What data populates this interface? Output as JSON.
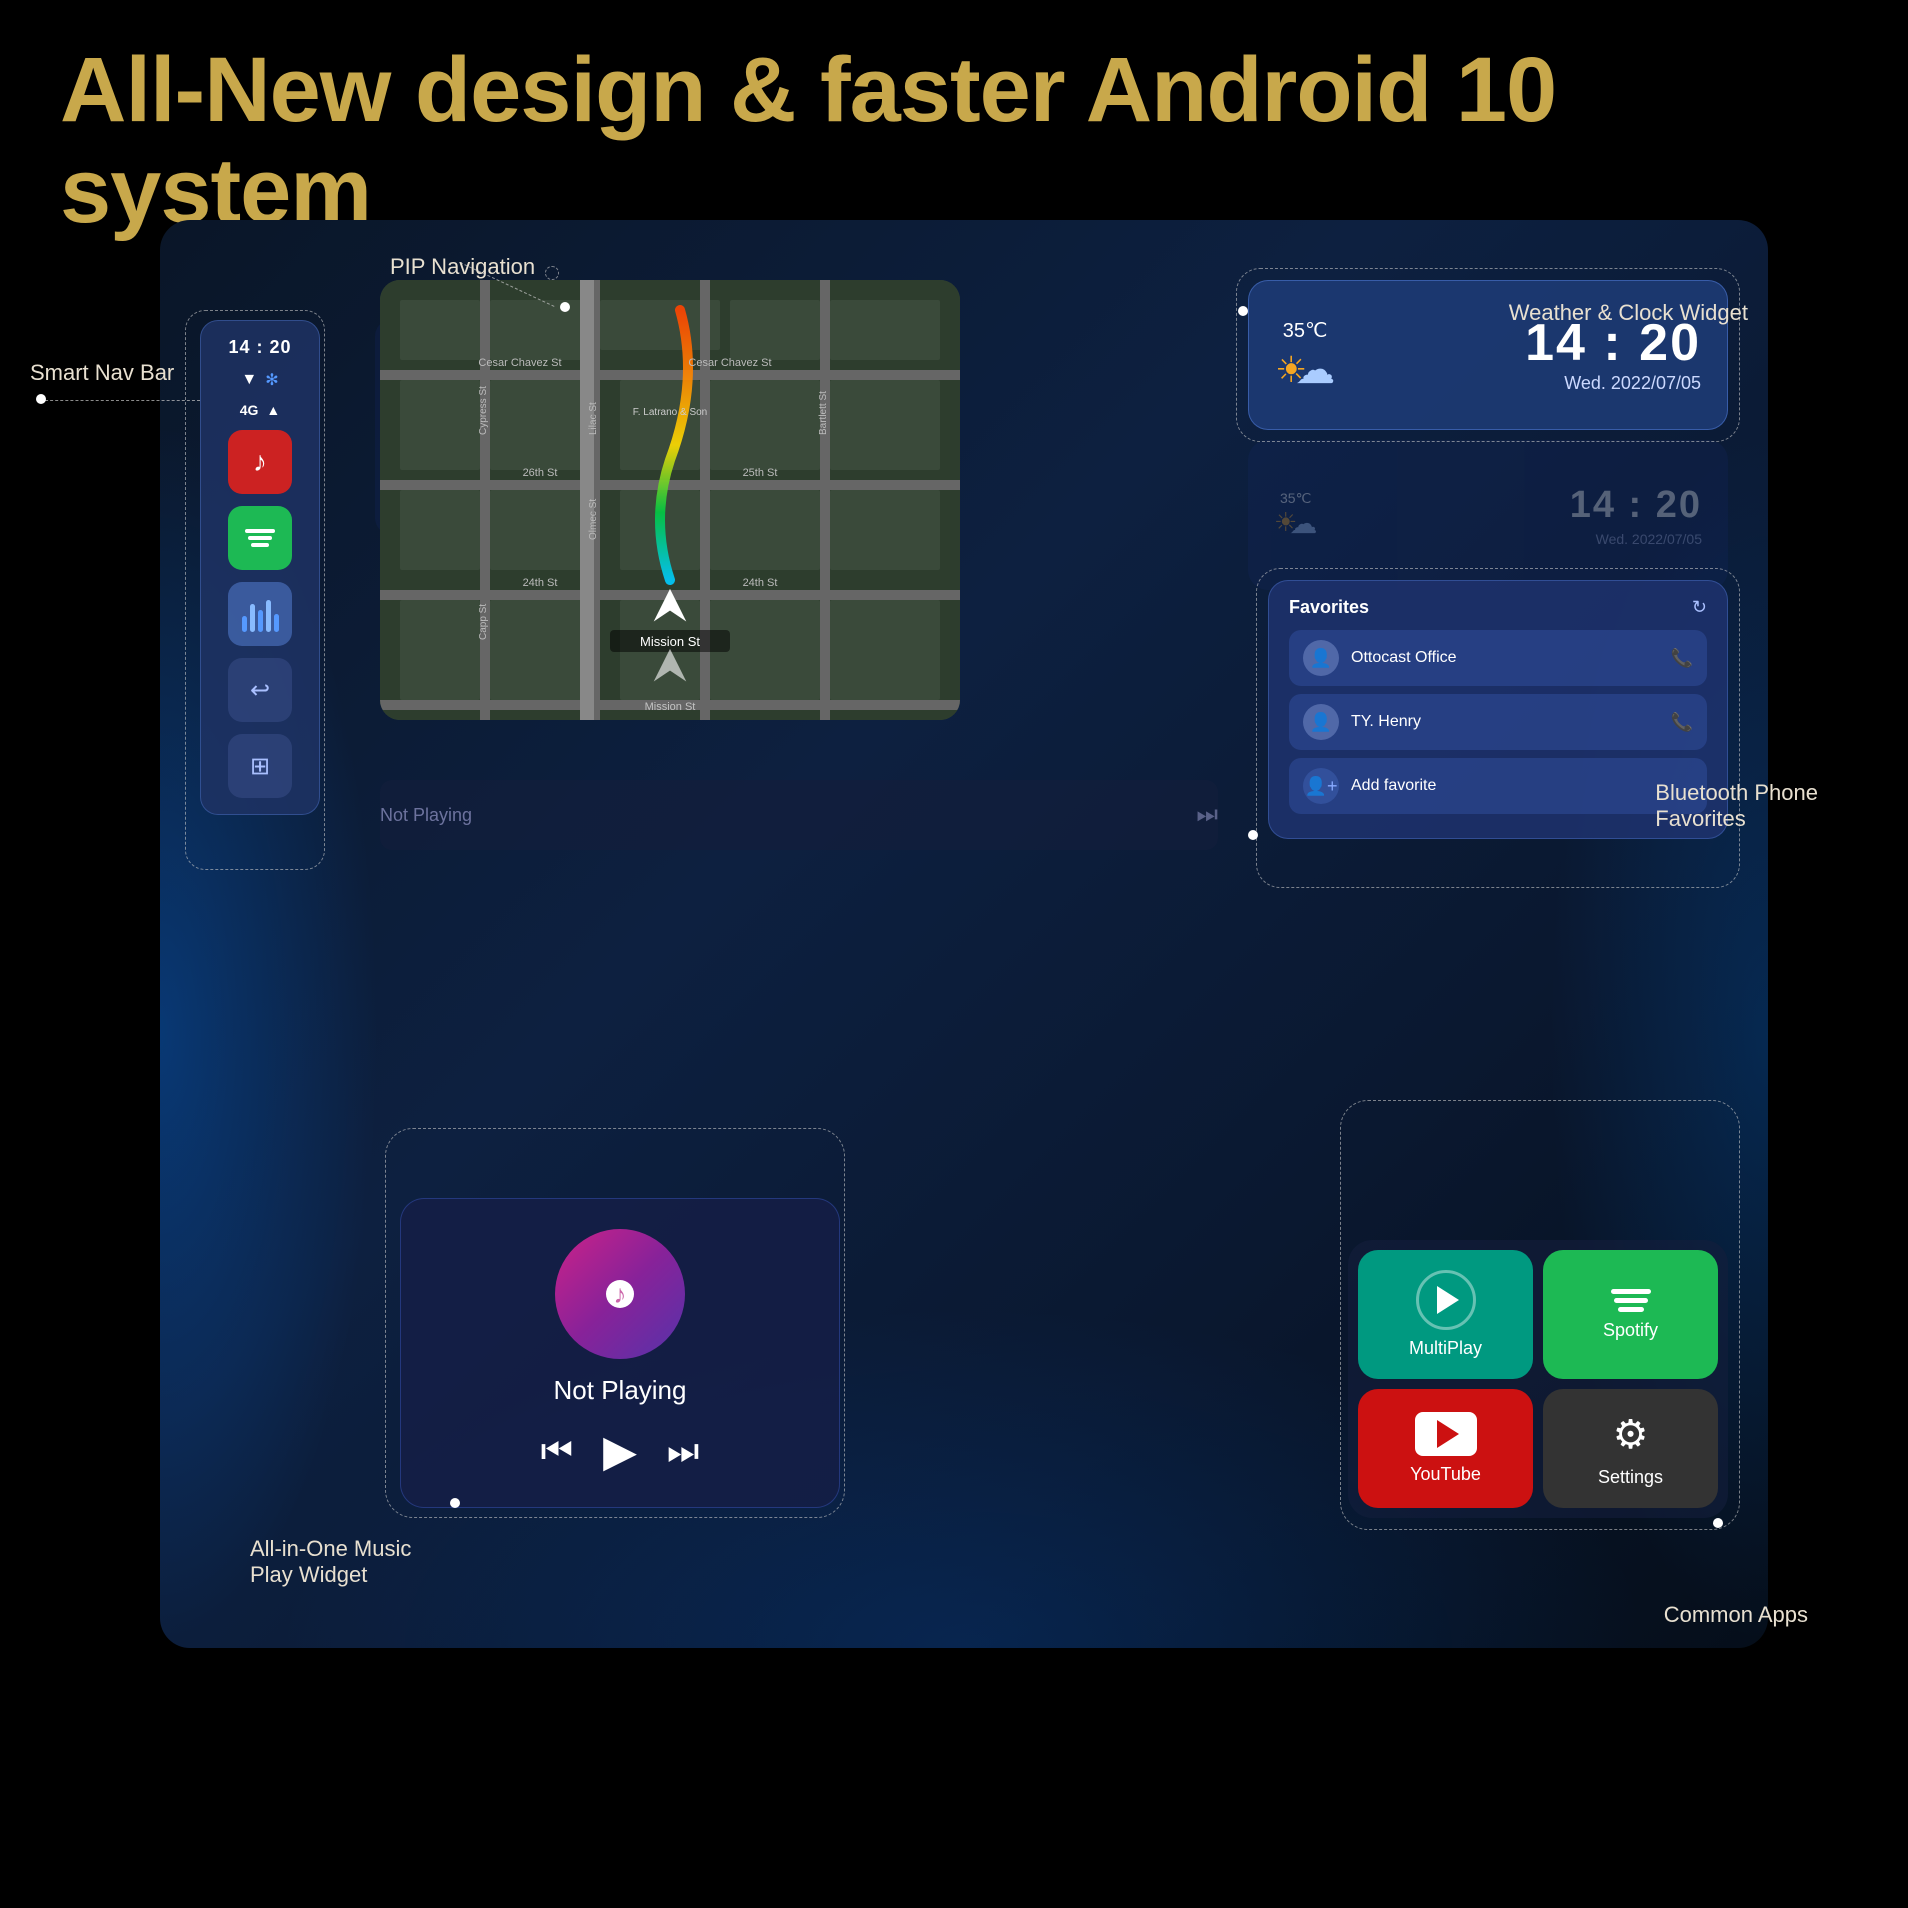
{
  "page": {
    "title": "All-New design & faster Android 10 system",
    "background_color": "#000000"
  },
  "header": {
    "title": "All-New design & faster Android 10 system"
  },
  "annotations": {
    "smart_nav_bar": "Smart Nav Bar",
    "pip_navigation": "PIP Navigation",
    "weather_clock_widget": "Weather & Clock Widget",
    "bluetooth_phone_favorites": "Bluetooth Phone\nFavorites",
    "all_in_one_music": "All-in-One Music\nPlay Widget",
    "common_apps": "Common Apps"
  },
  "smart_nav_bar": {
    "time": "14 : 20",
    "signal_icon": "▼",
    "bluetooth_icon": "⊛",
    "network_label": "4G",
    "signal_bars": "▲",
    "music_app_color": "#cc2222",
    "music_icon": "♪",
    "spotify_icon": "spotify",
    "voice_icon": "voice",
    "back_icon": "←",
    "grid_icon": "⊞"
  },
  "weather_widget": {
    "temperature": "35℃",
    "time": "14 : 20",
    "date": "Wed. 2022/07/05",
    "weather_desc": "Partly Cloudy"
  },
  "favorites_widget": {
    "title": "Favorites",
    "contact1": "Ottocast Office",
    "contact2": "TY. Henry",
    "add_label": "Add favorite",
    "refresh_icon": "↻"
  },
  "music_widget": {
    "status": "Not Playing",
    "prev_icon": "⏮",
    "play_icon": "▶",
    "next_icon": "⏭"
  },
  "apps_widget": {
    "app1_label": "MultiPlay",
    "app2_label": "Spotify",
    "app3_label": "YouTube",
    "app4_label": "Settings"
  },
  "map_widget": {
    "location_label": "Mission St",
    "streets": [
      "Cesar Chavez St",
      "26th St",
      "25th St",
      "24th St",
      "Mission St",
      "Cypress St",
      "Lilac St",
      "Bartlett St"
    ]
  }
}
